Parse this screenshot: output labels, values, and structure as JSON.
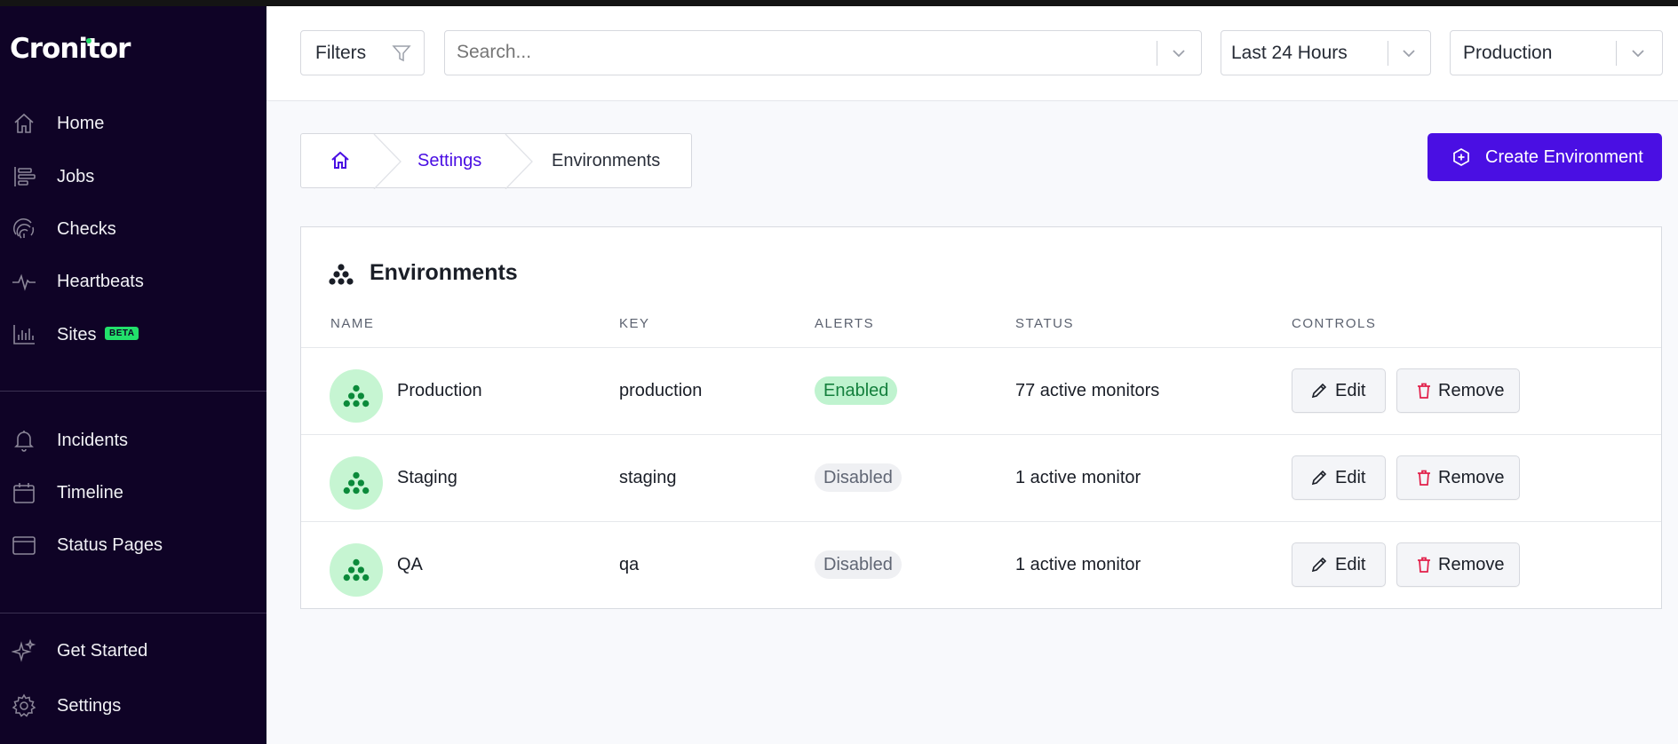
{
  "app": {
    "logo": "Cronitor",
    "accent": "#4a0fe3",
    "success": "#22e06b"
  },
  "sidebar": {
    "items": [
      {
        "label": "Home",
        "icon": "home-icon"
      },
      {
        "label": "Jobs",
        "icon": "jobs-icon"
      },
      {
        "label": "Checks",
        "icon": "fingerprint-icon"
      },
      {
        "label": "Heartbeats",
        "icon": "pulse-icon"
      },
      {
        "label": "Sites",
        "icon": "bar-chart-icon",
        "badge": "BETA"
      },
      {
        "label": "Incidents",
        "icon": "bell-icon"
      },
      {
        "label": "Timeline",
        "icon": "calendar-icon"
      },
      {
        "label": "Status Pages",
        "icon": "browser-window-icon"
      },
      {
        "label": "Get Started",
        "icon": "sparkles-icon"
      },
      {
        "label": "Settings",
        "icon": "gear-icon"
      }
    ]
  },
  "header": {
    "filters_label": "Filters",
    "search_placeholder": "Search...",
    "time_range": "Last 24 Hours",
    "environment": "Production"
  },
  "breadcrumb": {
    "settings": "Settings",
    "current": "Environments"
  },
  "create_button": "Create Environment",
  "table": {
    "title": "Environments",
    "columns": [
      "NAME",
      "KEY",
      "ALERTS",
      "STATUS",
      "CONTROLS"
    ],
    "rows": [
      {
        "name": "Production",
        "key": "production",
        "alerts": "Enabled",
        "status": "77 active monitors"
      },
      {
        "name": "Staging",
        "key": "staging",
        "alerts": "Disabled",
        "status": "1 active monitor"
      },
      {
        "name": "QA",
        "key": "qa",
        "alerts": "Disabled",
        "status": "1 active monitor"
      }
    ],
    "edit_label": "Edit",
    "remove_label": "Remove"
  }
}
